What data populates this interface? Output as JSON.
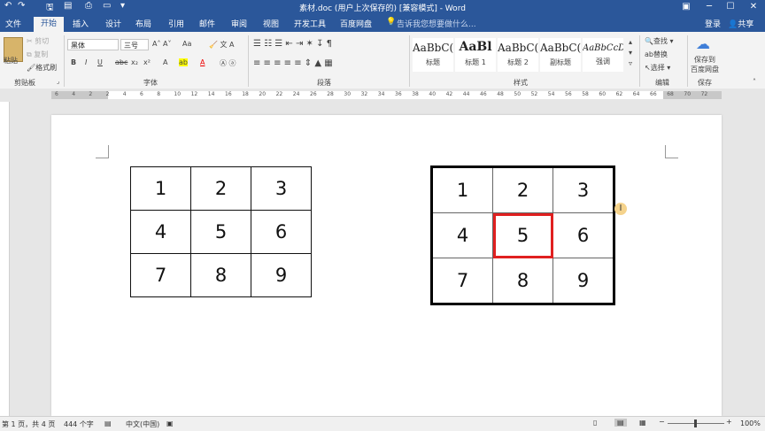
{
  "window": {
    "title": "素材.doc (用户上次保存的) [兼容模式] - Word",
    "login": "登录",
    "share": "共享",
    "search_hint": "告诉我您想要做什么..."
  },
  "tabs": [
    "文件",
    "开始",
    "插入",
    "设计",
    "布局",
    "引用",
    "邮件",
    "审阅",
    "视图",
    "开发工具",
    "百度网盘"
  ],
  "active_tab": "开始",
  "ribbon": {
    "clipboard": {
      "paste": "粘贴",
      "cut": "剪切",
      "copy": "复制",
      "format_painter": "格式刷",
      "label": "剪贴板"
    },
    "font": {
      "font_name": "黑体",
      "font_size": "三号",
      "label": "字体",
      "case": "Aa",
      "bold": "B",
      "italic": "I",
      "underline": "U",
      "strike": "abc",
      "subscript": "x₂",
      "superscript": "x²"
    },
    "paragraph": {
      "label": "段落"
    },
    "styles": {
      "label": "样式",
      "items": [
        {
          "sample": "AaBbC(",
          "name": "标题"
        },
        {
          "sample": "AaBl",
          "name": "标题 1"
        },
        {
          "sample": "AaBbC(",
          "name": "标题 2"
        },
        {
          "sample": "AaBbC(",
          "name": "副标题"
        },
        {
          "sample": "AaBbCcD",
          "name": "强调"
        }
      ]
    },
    "editing": {
      "find": "查找",
      "replace": "替换",
      "select": "选择",
      "label": "编辑"
    },
    "save": {
      "line1": "保存到",
      "line2": "百度网盘",
      "label": "保存"
    }
  },
  "ruler_ticks": [
    "6",
    "4",
    "2",
    "2",
    "4",
    "6",
    "8",
    "10",
    "12",
    "14",
    "16",
    "18",
    "20",
    "22",
    "24",
    "26",
    "28",
    "30",
    "32",
    "34",
    "36",
    "38",
    "40",
    "42",
    "44",
    "46",
    "48",
    "50",
    "52",
    "54",
    "56",
    "58",
    "60",
    "62",
    "64",
    "66",
    "68",
    "70",
    "72"
  ],
  "document": {
    "table_left": [
      [
        "1",
        "2",
        "3"
      ],
      [
        "4",
        "5",
        "6"
      ],
      [
        "7",
        "8",
        "9"
      ]
    ],
    "table_right": [
      [
        "1",
        "2",
        "3"
      ],
      [
        "4",
        "5",
        "6"
      ],
      [
        "7",
        "8",
        "9"
      ]
    ],
    "highlight_color": "#e02020"
  },
  "status": {
    "page": "第 1 页，共 4 页",
    "words": "444 个字",
    "language": "中文(中国)",
    "zoom": "100%"
  }
}
